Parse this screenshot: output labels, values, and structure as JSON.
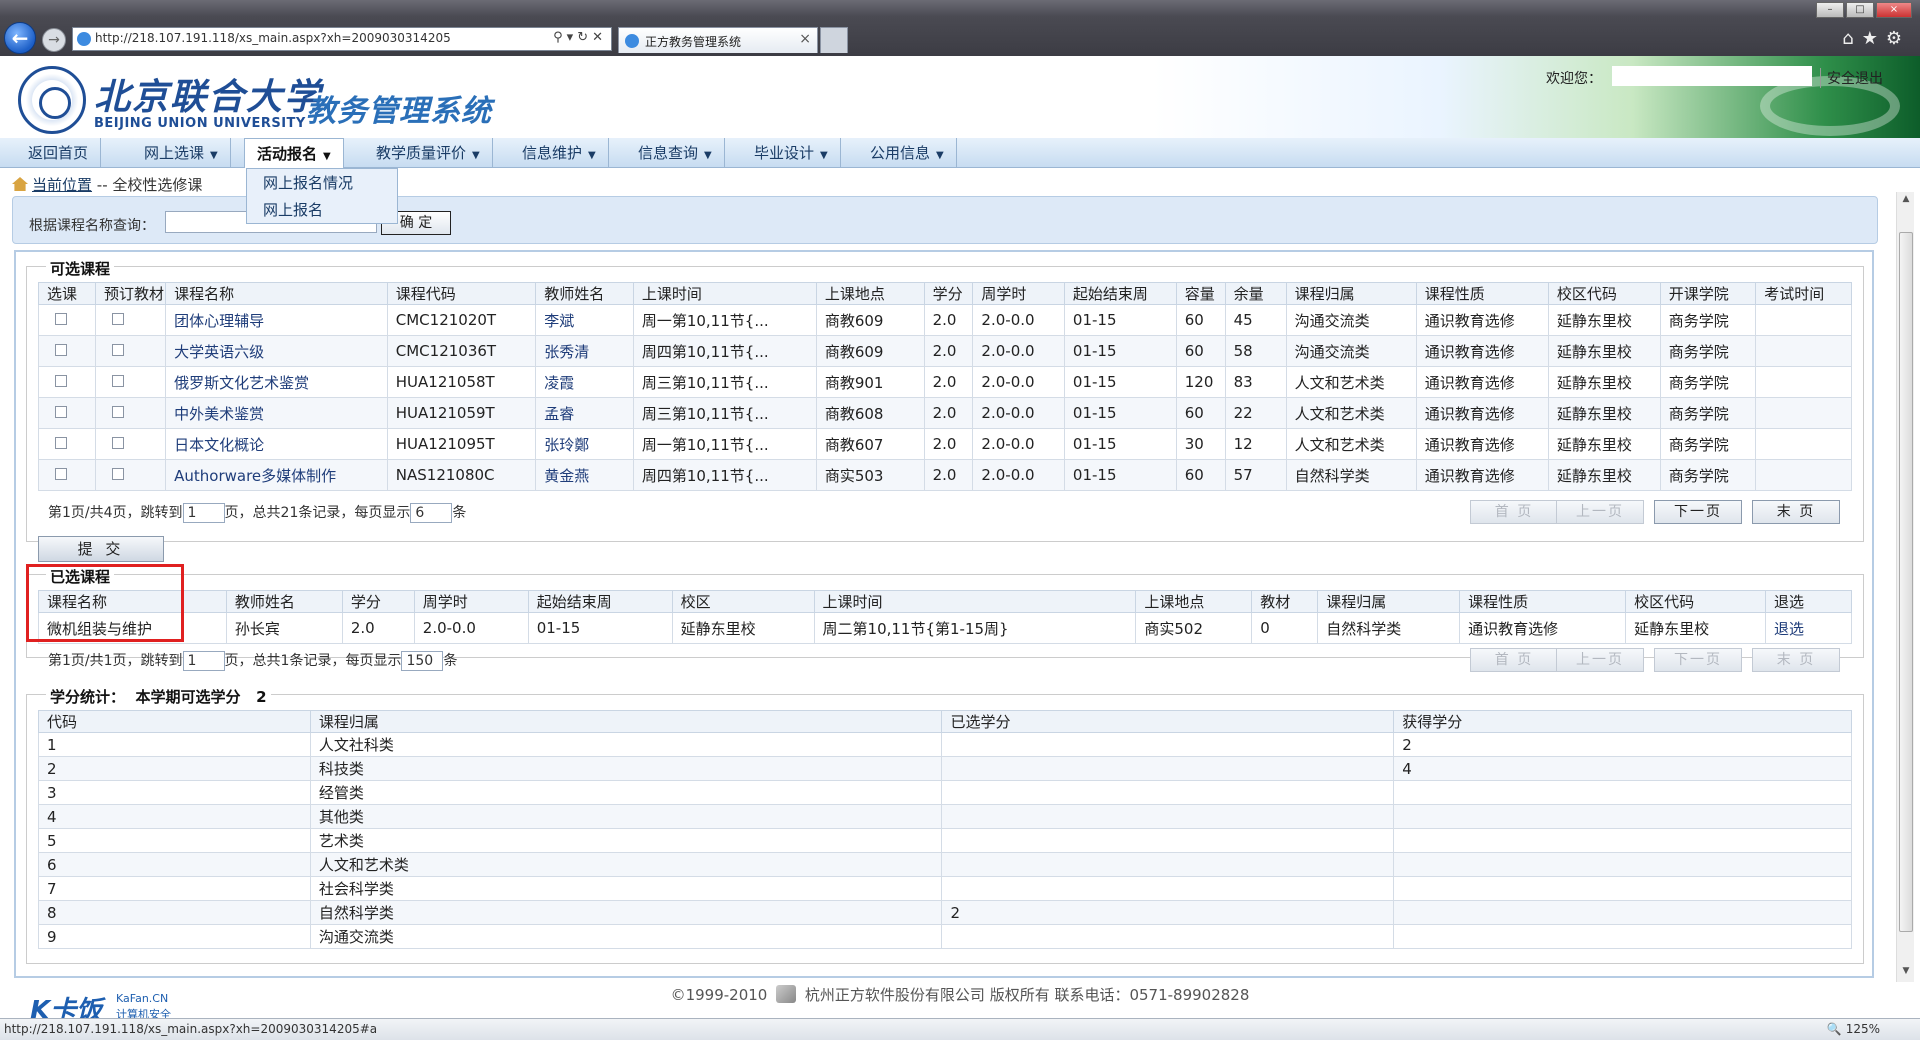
{
  "browser": {
    "url": "http://218.107.191.118/xs_main.aspx?xh=2009030314205",
    "tab_title": "正方教务管理系统",
    "status_url": "http://218.107.191.118/xs_main.aspx?xh=2009030314205#a",
    "zoom": "125%"
  },
  "header": {
    "university_cn": "北京联合大学",
    "university_en": "BEIJING UNION UNIVERSITY",
    "system_title": "教务管理系统",
    "welcome": "欢迎您：",
    "logout": "安全退出"
  },
  "nav": {
    "items": [
      {
        "label": "返回首页"
      },
      {
        "label": "网上选课"
      },
      {
        "label": "活动报名"
      },
      {
        "label": "教学质量评价"
      },
      {
        "label": "信息维护"
      },
      {
        "label": "信息查询"
      },
      {
        "label": "毕业设计"
      },
      {
        "label": "公用信息"
      }
    ],
    "dropdown": [
      "网上报名情况",
      "网上报名"
    ]
  },
  "breadcrumb": {
    "location": "当前位置",
    "page": "-- 全校性选修课"
  },
  "search": {
    "label": "根据课程名称查询：",
    "value": "",
    "button": "确 定"
  },
  "available": {
    "legend": "可选课程",
    "columns": [
      "选课",
      "预订教材",
      "课程名称",
      "课程代码",
      "教师姓名",
      "上课时间",
      "上课地点",
      "学分",
      "周学时",
      "起始结束周",
      "容量",
      "余量",
      "课程归属",
      "课程性质",
      "校区代码",
      "开课学院",
      "考试时间"
    ],
    "rows": [
      [
        "团体心理辅导",
        "CMC121020T",
        "李斌",
        "周一第10,11节{...",
        "商教609",
        "2.0",
        "2.0-0.0",
        "01-15",
        "60",
        "45",
        "沟通交流类",
        "通识教育选修",
        "延静东里校",
        "商务学院",
        ""
      ],
      [
        "大学英语六级",
        "CMC121036T",
        "张秀清",
        "周四第10,11节{...",
        "商教609",
        "2.0",
        "2.0-0.0",
        "01-15",
        "60",
        "58",
        "沟通交流类",
        "通识教育选修",
        "延静东里校",
        "商务学院",
        ""
      ],
      [
        "俄罗斯文化艺术鉴赏",
        "HUA121058T",
        "凌霞",
        "周三第10,11节{...",
        "商教901",
        "2.0",
        "2.0-0.0",
        "01-15",
        "120",
        "83",
        "人文和艺术类",
        "通识教育选修",
        "延静东里校",
        "商务学院",
        ""
      ],
      [
        "中外美术鉴赏",
        "HUA121059T",
        "孟睿",
        "周三第10,11节{...",
        "商教608",
        "2.0",
        "2.0-0.0",
        "01-15",
        "60",
        "22",
        "人文和艺术类",
        "通识教育选修",
        "延静东里校",
        "商务学院",
        ""
      ],
      [
        "日本文化概论",
        "HUA121095T",
        "张玲鄭",
        "周一第10,11节{...",
        "商教607",
        "2.0",
        "2.0-0.0",
        "01-15",
        "30",
        "12",
        "人文和艺术类",
        "通识教育选修",
        "延静东里校",
        "商务学院",
        ""
      ],
      [
        "Authorware多媒体制作",
        "NAS121080C",
        "黄金燕",
        "周四第10,11节{...",
        "商实503",
        "2.0",
        "2.0-0.0",
        "01-15",
        "60",
        "57",
        "自然科学类",
        "通识教育选修",
        "延静东里校",
        "商务学院",
        ""
      ]
    ],
    "pager": {
      "prefix": "第1页/共4页，跳转到",
      "page": "1",
      "middle": "页，总共21条记录，每页显示",
      "per_page": "6",
      "suffix": "条"
    },
    "buttons": {
      "first": "首 页",
      "prev": "上一页",
      "next": "下一页",
      "last": "末 页"
    },
    "submit": "提 交"
  },
  "selected": {
    "legend": "已选课程",
    "columns": [
      "课程名称",
      "教师姓名",
      "学分",
      "周学时",
      "起始结束周",
      "校区",
      "上课时间",
      "上课地点",
      "教材",
      "课程归属",
      "课程性质",
      "校区代码",
      "退选"
    ],
    "rows": [
      [
        "微机组装与维护",
        "孙长宾",
        "2.0",
        "2.0-0.0",
        "01-15",
        "延静东里校",
        "周二第10,11节{第1-15周}",
        "商实502",
        "0",
        "自然科学类",
        "通识教育选修",
        "延静东里校",
        "退选"
      ]
    ],
    "pager": {
      "prefix": "第1页/共1页，跳转到",
      "page": "1",
      "middle": "页，总共1条记录，每页显示",
      "per_page": "150",
      "suffix": "条"
    },
    "buttons": {
      "first": "首 页",
      "prev": "上一页",
      "next": "下一页",
      "last": "末 页"
    }
  },
  "credits": {
    "legend": "学分统计：",
    "summary_label": "本学期可选学分",
    "summary_value": "2",
    "columns": [
      "代码",
      "课程归属",
      "已选学分",
      "获得学分"
    ],
    "rows": [
      [
        "1",
        "人文社科类",
        "",
        "2"
      ],
      [
        "2",
        "科技类",
        "",
        "4"
      ],
      [
        "3",
        "经管类",
        "",
        ""
      ],
      [
        "4",
        "其他类",
        "",
        ""
      ],
      [
        "5",
        "艺术类",
        "",
        ""
      ],
      [
        "6",
        "人文和艺术类",
        "",
        ""
      ],
      [
        "7",
        "社会科学类",
        "",
        ""
      ],
      [
        "8",
        "自然科学类",
        "2",
        ""
      ],
      [
        "9",
        "沟通交流类",
        "",
        ""
      ]
    ]
  },
  "footer": {
    "copyright": "©1999-2010",
    "company": "杭州正方软件股份有限公司 版权所有 联系电话：0571-89902828"
  },
  "watermark": {
    "brand": "K卡饭",
    "line1": "KaFan.CN",
    "line2": "计算机安全"
  }
}
